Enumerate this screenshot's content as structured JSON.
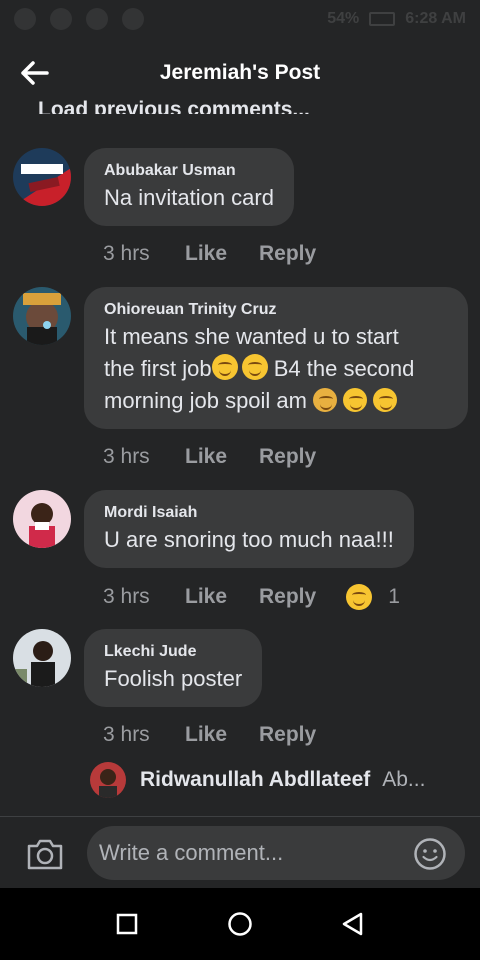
{
  "status_bar": {
    "battery": "54%",
    "time": "6:28 AM"
  },
  "header": {
    "title": "Jeremiah's Post",
    "back_icon": "arrow-left-icon"
  },
  "load_previous": "Load previous comments...",
  "comments": [
    {
      "author": "Abubakar Usman",
      "text": "Na invitation card",
      "time": "3 hrs",
      "like_label": "Like",
      "reply_label": "Reply"
    },
    {
      "author": "Ohioreuan Trinity Cruz",
      "text_lines": [
        "It means she wanted u to start",
        "the first job",
        "B4 the second",
        "morning job spoil am"
      ],
      "time": "3 hrs",
      "like_label": "Like",
      "reply_label": "Reply"
    },
    {
      "author": "Mordi Isaiah",
      "text": "U are snoring too much naa!!!",
      "time": "3 hrs",
      "like_label": "Like",
      "reply_label": "Reply",
      "reaction_count": "1"
    },
    {
      "author": "Lkechi Jude",
      "text": "Foolish poster",
      "time": "3 hrs",
      "like_label": "Like",
      "reply_label": "Reply"
    }
  ],
  "reply_preview": {
    "author": "Ridwanullah Abdllateef",
    "snippet": "Ab..."
  },
  "composer": {
    "placeholder": "Write a comment...",
    "camera_icon": "camera-icon",
    "emoji_icon": "smiley-icon"
  },
  "colors": {
    "background": "#242526",
    "bubble": "#3a3b3c",
    "text": "#e4e6eb",
    "secondary_text": "#9a9ca0"
  }
}
